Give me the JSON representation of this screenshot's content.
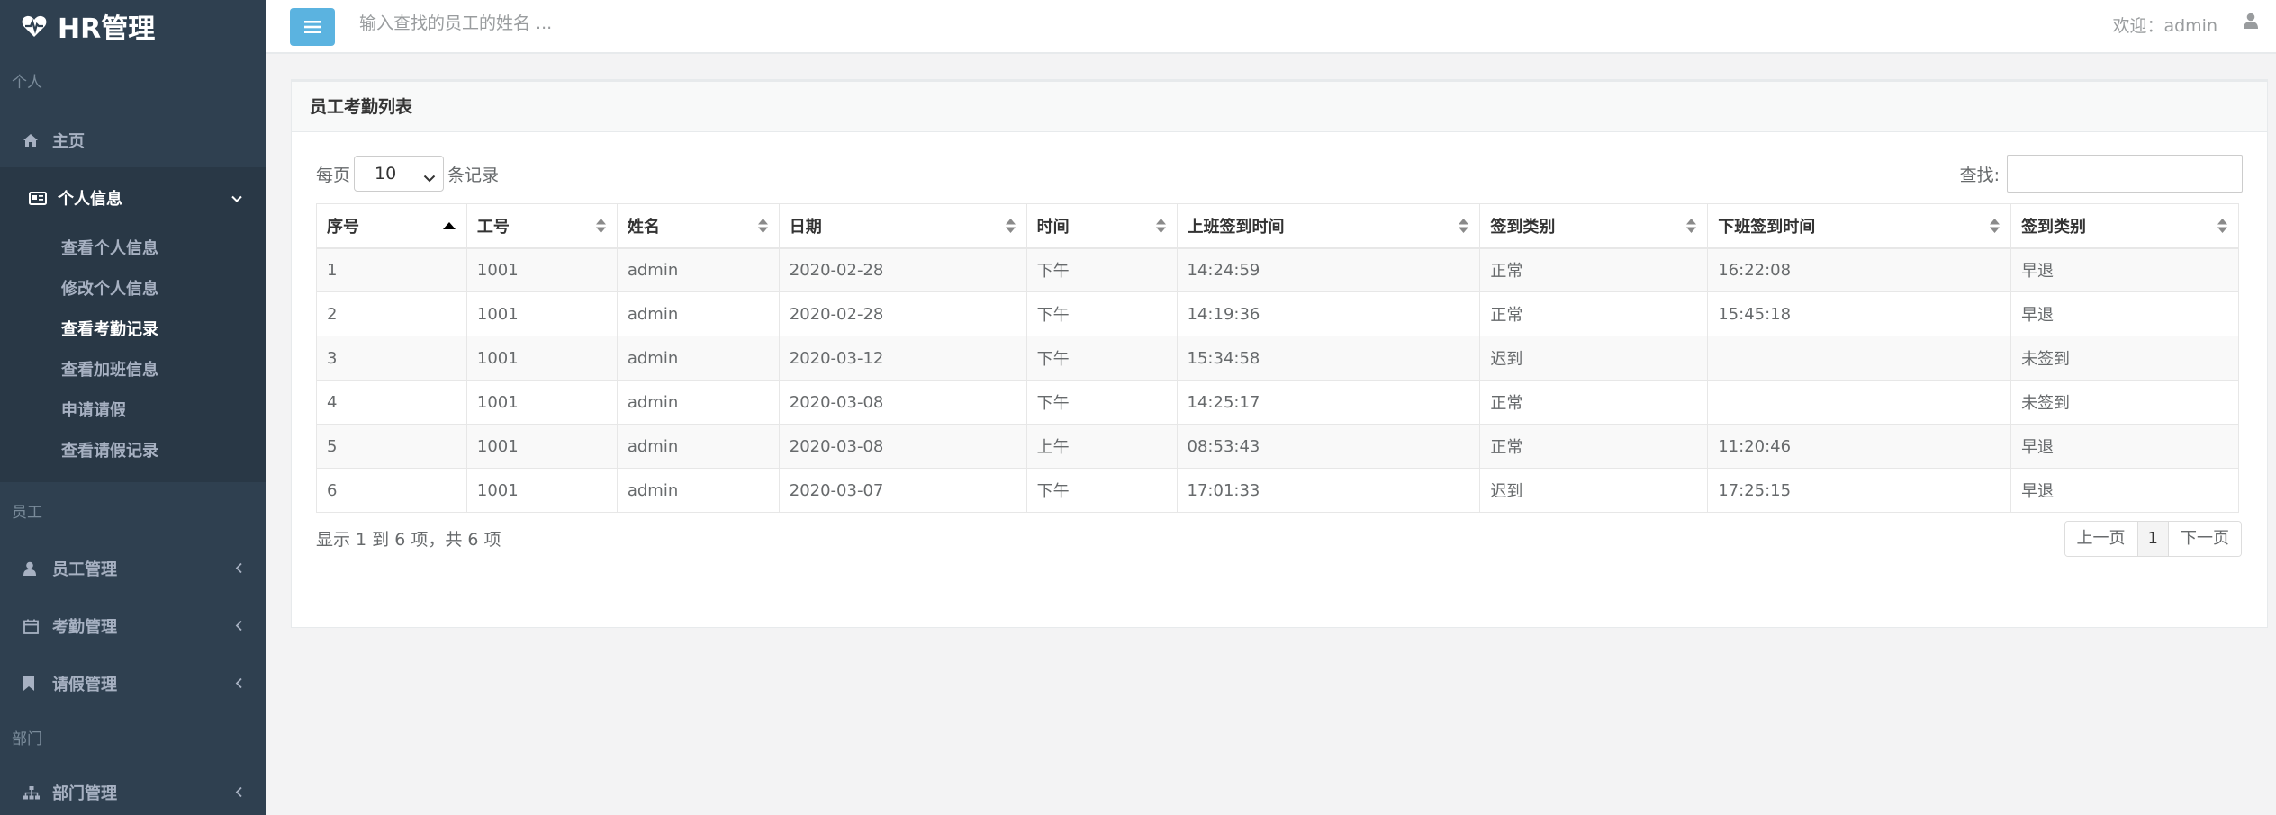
{
  "app": {
    "title": "HR管理"
  },
  "sidebar": {
    "section_personal": "个人",
    "home_label": "主页",
    "personal_info_label": "个人信息",
    "sub_items": [
      "查看个人信息",
      "修改个人信息",
      "查看考勤记录",
      "查看加班信息",
      "申请请假",
      "查看请假记录"
    ],
    "section_staff": "员工",
    "staff_mgmt_label": "员工管理",
    "attendance_mgmt_label": "考勤管理",
    "leave_mgmt_label": "请假管理",
    "section_dept": "部门",
    "dept_mgmt_label": "部门管理"
  },
  "topbar": {
    "search_placeholder": "输入查找的员工的姓名 ...",
    "welcome": "欢迎：admin"
  },
  "panel": {
    "title": "员工考勤列表",
    "per_page_prefix": "每页",
    "per_page_value": "10",
    "per_page_suffix": "条记录",
    "search_label": "查找:"
  },
  "table": {
    "headers": [
      "序号",
      "工号",
      "姓名",
      "日期",
      "时间",
      "上班签到时间",
      "签到类别",
      "下班签到时间",
      "签到类别"
    ],
    "rows": [
      [
        "1",
        "1001",
        "admin",
        "2020-02-28",
        "下午",
        "14:24:59",
        "正常",
        "16:22:08",
        "早退"
      ],
      [
        "2",
        "1001",
        "admin",
        "2020-02-28",
        "下午",
        "14:19:36",
        "正常",
        "15:45:18",
        "早退"
      ],
      [
        "3",
        "1001",
        "admin",
        "2020-03-12",
        "下午",
        "15:34:58",
        "迟到",
        "",
        "未签到"
      ],
      [
        "4",
        "1001",
        "admin",
        "2020-03-08",
        "下午",
        "14:25:17",
        "正常",
        "",
        "未签到"
      ],
      [
        "5",
        "1001",
        "admin",
        "2020-03-08",
        "上午",
        "08:53:43",
        "正常",
        "11:20:46",
        "早退"
      ],
      [
        "6",
        "1001",
        "admin",
        "2020-03-07",
        "下午",
        "17:01:33",
        "迟到",
        "17:25:15",
        "早退"
      ]
    ]
  },
  "footer": {
    "info": "显示 1 到 6 项，共 6 项",
    "prev": "上一页",
    "page": "1",
    "next": "下一页"
  }
}
